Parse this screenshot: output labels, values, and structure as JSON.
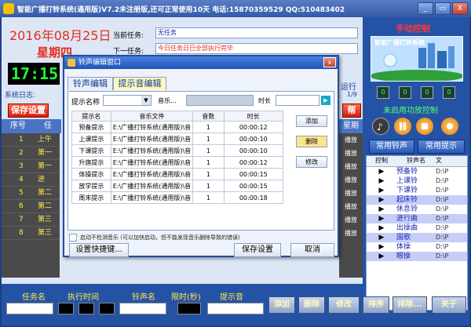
{
  "app": {
    "title": "智能广播打铃系统(通用版)V7.2未注册版,还可正常使用10天 电话:15870359529 QQ:510483402"
  },
  "window_buttons": {
    "minimize": "_",
    "restore": "▭",
    "close": "X"
  },
  "left": {
    "date": "2016年08月25日",
    "weekday": "星期四",
    "clock": "17:15",
    "current_task_label": "当前任务:",
    "current_task_value": "无任务",
    "next_task_label": "下一任务:",
    "next_task_value": "今日任务日已全部执行完毕",
    "system_log_label": "系统日志:",
    "running_label": "运行",
    "page_indicator": "1/9",
    "red_button": "保存设置",
    "red_button2": "帮",
    "grid_headers": [
      "序号",
      "任"
    ],
    "grid_rows": [
      "1",
      "2",
      "3",
      "4",
      "5",
      "6",
      "7",
      "8"
    ],
    "grid_row_texts": [
      "上午",
      "第一",
      "第一",
      "进",
      "第二",
      "第二",
      "第三",
      "第三"
    ],
    "side_header": "星期",
    "side_cells": [
      "播放",
      "播放",
      "播放",
      "播放",
      "播放",
      "播放",
      "播放",
      "播放"
    ]
  },
  "right": {
    "manual_title": "手动控制",
    "banner_text": "智能广播打铃系统",
    "lamps": [
      "0",
      "0",
      "0",
      "0"
    ],
    "amp_status": "未启用功放控制",
    "btn_common_ring": "常用铃声",
    "btn_common_tip": "常用提示",
    "list_headers": [
      "控制",
      "铃声名",
      "文"
    ],
    "ring_items": [
      {
        "name": "预备铃",
        "file": "D:\\P"
      },
      {
        "name": "上课铃",
        "file": "D:\\P"
      },
      {
        "name": "下课铃",
        "file": "D:\\P"
      },
      {
        "name": "起床铃",
        "file": "D:\\P"
      },
      {
        "name": "休息铃",
        "file": "D:\\P"
      },
      {
        "name": "进行曲",
        "file": "D:\\P"
      },
      {
        "name": "出操曲",
        "file": "D:\\P"
      },
      {
        "name": "国歌",
        "file": "D:\\P"
      },
      {
        "name": "体操",
        "file": "D:\\P"
      },
      {
        "name": "眼操",
        "file": "D:\\P"
      }
    ]
  },
  "bottom": {
    "task_name_label": "任务名",
    "exec_time_label": "执行时间",
    "ring_name_label": "铃声名",
    "time_limit_label": "限时(秒)",
    "tip_sound_label": "提示音",
    "btn_add": "添加",
    "btn_delete": "删除",
    "btn_modify": "修改",
    "btn_sort": "排序",
    "btn_exclude": "排除...",
    "btn_about": "关于"
  },
  "dialog": {
    "title": "铃声编辑窗口",
    "tab1": "铃声编辑",
    "tab2": "提示音编辑",
    "tip_name_label": "提示名称",
    "music_label": "音乐...",
    "duration_label": "时长",
    "columns": [
      "提示名",
      "音乐文件",
      "音数",
      "时长"
    ],
    "rows": [
      [
        "预备提示",
        "E:\\广播打铃系统(通用版)\\音",
        "1",
        "00:00:12"
      ],
      [
        "上课提示",
        "E:\\广播打铃系统(通用版)\\音",
        "1",
        "00:00:10"
      ],
      [
        "下课提示",
        "E:\\广播打铃系统(通用版)\\音",
        "1",
        "00:00:10"
      ],
      [
        "升旗提示",
        "E:\\广播打铃系统(通用版)\\音",
        "1",
        "00:00:12"
      ],
      [
        "体操提示",
        "E:\\广播打铃系统(通用版)\\音",
        "1",
        "00:00:15"
      ],
      [
        "放学提示",
        "E:\\广播打铃系统(通用版)\\音",
        "1",
        "00:00:15"
      ],
      [
        "周末提示",
        "E:\\广播打铃系统(通用版)\\音",
        "1",
        "00:00:18"
      ]
    ],
    "btn_add": "添加",
    "btn_delete": "删除",
    "btn_modify": "修改",
    "checkbox_label": "启动不检测音乐 (可以加快启动，但不能发现音乐删除导致的错误)",
    "btn_shortcut": "设置快捷键...",
    "btn_save": "保存设置",
    "btn_cancel": "取消"
  }
}
